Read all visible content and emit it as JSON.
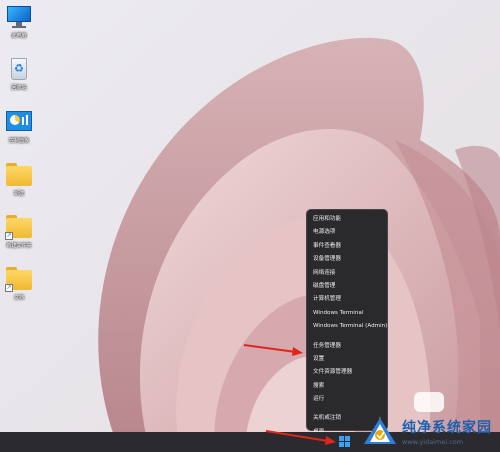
{
  "desktop": {
    "icons": [
      {
        "label": "此电脑",
        "icon": "monitor-icon"
      },
      {
        "label": "回收站",
        "icon": "recycle-bin-icon"
      },
      {
        "label": "控制面板",
        "icon": "control-panel-icon"
      },
      {
        "label": "新建",
        "icon": "folder-icon"
      },
      {
        "label": "新建文件夹",
        "icon": "folder-shortcut-icon"
      },
      {
        "label": "文档",
        "icon": "folder-shortcut-icon"
      }
    ]
  },
  "context_menu": {
    "items": [
      "应用和功能",
      "电源选项",
      "事件查看器",
      "设备管理器",
      "网络连接",
      "磁盘管理",
      "计算机管理",
      "Windows Terminal",
      "Windows Terminal (Admin)",
      "任务管理器",
      "设置",
      "文件资源管理器",
      "搜索",
      "运行",
      "关机或注销",
      "桌面"
    ],
    "submenu_item": "关机或注销",
    "highlighted_item": "设置"
  },
  "taskbar": {
    "start_icon": "windows-start-icon"
  },
  "watermark": {
    "title": "纯净系统家园",
    "url": "www.yidaimei.com"
  },
  "colors": {
    "menu_bg": "#2a2a2c",
    "taskbar_bg": "#2b2a2e",
    "arrow_red": "#e0251b",
    "accent_blue": "#3aa2f3"
  }
}
